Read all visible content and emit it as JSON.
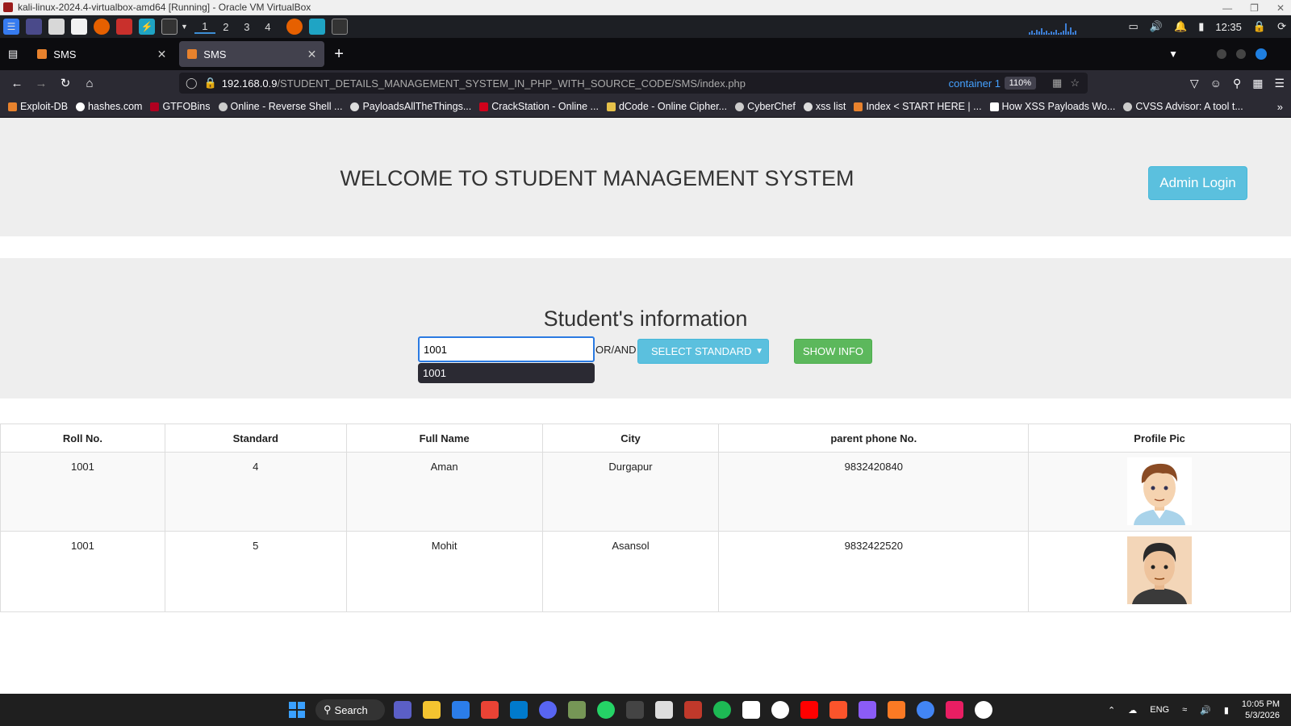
{
  "vbox": {
    "title": "kali-linux-2024.4-virtualbox-amd64 [Running] - Oracle VM VirtualBox"
  },
  "kali_panel": {
    "workspaces": [
      "1",
      "2",
      "3",
      "4"
    ],
    "time": "12:35"
  },
  "browser": {
    "tabs": [
      {
        "label": "SMS"
      },
      {
        "label": "SMS"
      }
    ],
    "url_host": "192.168.0.9",
    "url_path": "/STUDENT_DETAILS_MANAGEMENT_SYSTEM_IN_PHP_WITH_SOURCE_CODE/SMS/index.php",
    "container_label": "container 1",
    "zoom": "110%",
    "bookmarks": [
      {
        "label": "Exploit-DB",
        "color": "#e8822d"
      },
      {
        "label": "hashes.com",
        "color": "#ffffff"
      },
      {
        "label": "GTFOBins",
        "color": "#b00020"
      },
      {
        "label": "Online - Reverse Shell ...",
        "color": "#cccccc"
      },
      {
        "label": "PayloadsAllTheThings...",
        "color": "#dddddd"
      },
      {
        "label": "CrackStation - Online ...",
        "color": "#d0021b"
      },
      {
        "label": "dCode - Online Cipher...",
        "color": "#e6c14a"
      },
      {
        "label": "CyberChef",
        "color": "#cccccc"
      },
      {
        "label": "xss list",
        "color": "#dddddd"
      },
      {
        "label": "Index < START HERE | ...",
        "color": "#e8822d"
      },
      {
        "label": "How XSS Payloads Wo...",
        "color": "#ffffff"
      },
      {
        "label": "CVSS Advisor: A tool t...",
        "color": "#cccccc"
      }
    ]
  },
  "page": {
    "welcome_title": "WELCOME TO STUDENT MANAGEMENT SYSTEM",
    "admin_login_label": "Admin Login",
    "info_title": "Student's information",
    "roll_input_value": "1001",
    "autocomplete_option": "1001",
    "or_and_label": "OR/AND",
    "select_standard_label": "SELECT STANDARD",
    "show_info_label": "SHOW INFO",
    "table": {
      "headers": [
        "Roll No.",
        "Standard",
        "Full Name",
        "City",
        "parent phone No.",
        "Profile Pic"
      ],
      "rows": [
        {
          "roll": "1001",
          "standard": "4",
          "name": "Aman",
          "city": "Durgapur",
          "phone": "9832420840"
        },
        {
          "roll": "1001",
          "standard": "5",
          "name": "Mohit",
          "city": "Asansol",
          "phone": "9832422520"
        }
      ]
    }
  },
  "taskbar": {
    "search_label": "Search",
    "lang": "ENG",
    "time": "10:05 PM",
    "date": "5/3/2026"
  },
  "colors": {
    "info_button": "#5bc0de",
    "success_button": "#5cb85c",
    "jumbotron": "#eeeeee"
  }
}
